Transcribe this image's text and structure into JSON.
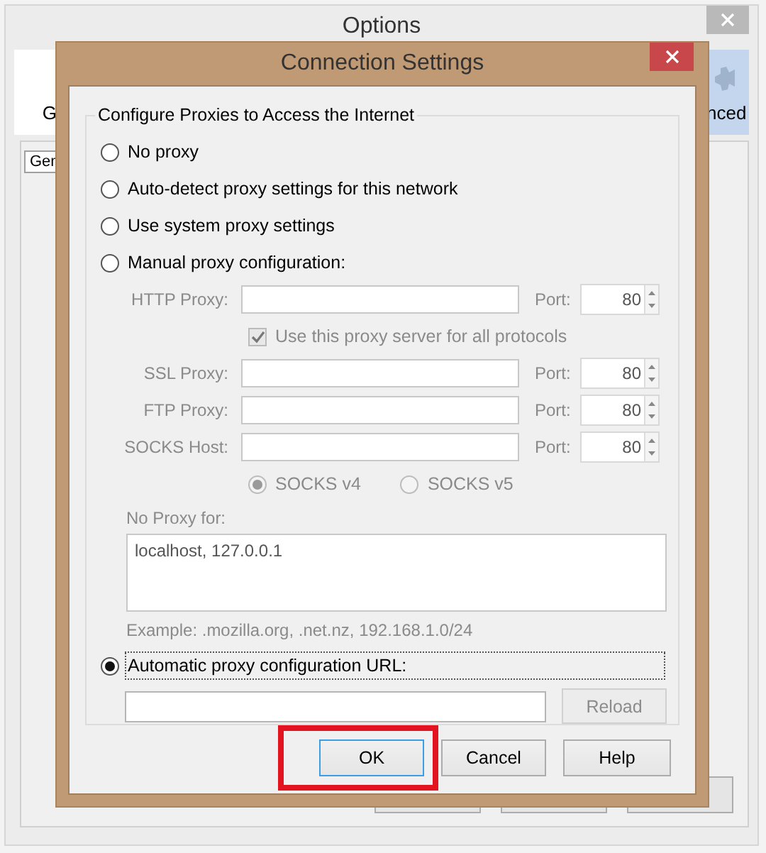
{
  "background_window": {
    "title": "Options",
    "tabs": [
      {
        "label": "G",
        "selected": false
      },
      {
        "label": "nced",
        "selected": true
      }
    ],
    "subtab": "Gen"
  },
  "dialog": {
    "title": "Connection Settings",
    "group_title": "Configure Proxies to Access the Internet",
    "proxy_modes": [
      {
        "label": "No proxy",
        "selected": false
      },
      {
        "label": "Auto-detect proxy settings for this network",
        "selected": false
      },
      {
        "label": "Use system proxy settings",
        "selected": false
      },
      {
        "label": "Manual proxy configuration:",
        "selected": false
      }
    ],
    "manual": {
      "disabled": true,
      "http": {
        "label": "HTTP Proxy:",
        "port_label": "Port:",
        "port": "80"
      },
      "share_all": {
        "label": "Use this proxy server for all protocols",
        "checked": true
      },
      "others": [
        {
          "label": "SSL Proxy:",
          "port_label": "Port:",
          "port": "80"
        },
        {
          "label": "FTP Proxy:",
          "port_label": "Port:",
          "port": "80"
        },
        {
          "label": "SOCKS Host:",
          "port_label": "Port:",
          "port": "80"
        }
      ],
      "socks_versions": [
        {
          "label": "SOCKS v4",
          "selected": true
        },
        {
          "label": "SOCKS v5",
          "selected": false
        }
      ]
    },
    "no_proxy": {
      "label": "No Proxy for:",
      "value": "localhost, 127.0.0.1",
      "example": "Example: .mozilla.org, .net.nz, 192.168.1.0/24"
    },
    "auto_config": {
      "label": "Automatic proxy configuration URL:",
      "selected": true,
      "focused": true,
      "reload": {
        "label": "Reload",
        "disabled": true
      }
    },
    "buttons": [
      {
        "label": "OK",
        "default": true,
        "highlighted": true
      },
      {
        "label": "Cancel",
        "default": false,
        "highlighted": false
      },
      {
        "label": "Help",
        "default": false,
        "highlighted": false
      }
    ]
  }
}
